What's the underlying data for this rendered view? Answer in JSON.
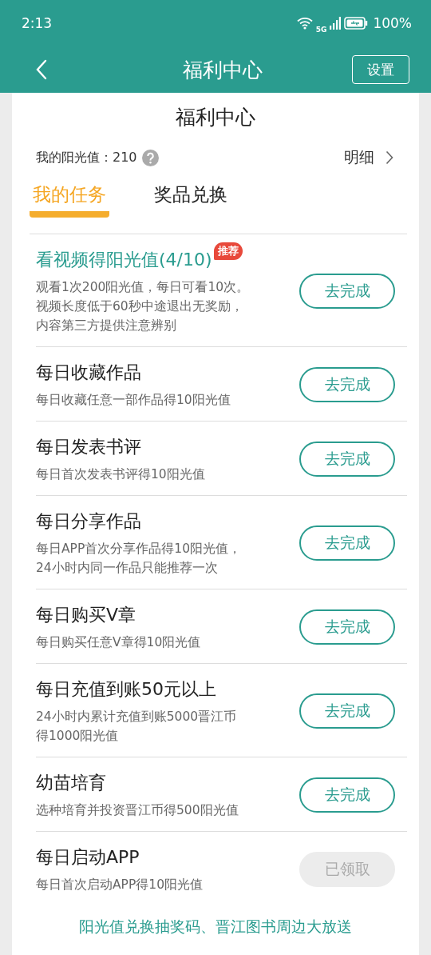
{
  "status_bar": {
    "time": "2:13",
    "network": "5G",
    "battery": "100%"
  },
  "header": {
    "title": "福利中心",
    "settings_button": "设置"
  },
  "card": {
    "title": "福利中心",
    "sunshine_label": "我的阳光值：",
    "sunshine_value": "210",
    "detail_link": "明细"
  },
  "tabs": [
    {
      "label": "我的任务",
      "selected": true
    },
    {
      "label": "奖品兑换",
      "selected": false
    }
  ],
  "tasks": [
    {
      "title": "看视频得阳光值(4/10)",
      "featured": true,
      "badge": "推荐",
      "desc_lines": [
        "观看1次200阳光值，每日可看10次。",
        "视频长度低于60秒中途退出无奖励，",
        "内容第三方提供注意辨别"
      ],
      "button": "去完成",
      "claimed": false
    },
    {
      "title": "每日收藏作品",
      "featured": false,
      "desc_lines": [
        "每日收藏任意一部作品得10阳光值"
      ],
      "button": "去完成",
      "claimed": false
    },
    {
      "title": "每日发表书评",
      "featured": false,
      "desc_lines": [
        "每日首次发表书评得10阳光值"
      ],
      "button": "去完成",
      "claimed": false
    },
    {
      "title": "每日分享作品",
      "featured": false,
      "desc_lines": [
        "每日APP首次分享作品得10阳光值，",
        "24小时内同一作品只能推荐一次"
      ],
      "button": "去完成",
      "claimed": false
    },
    {
      "title": "每日购买V章",
      "featured": false,
      "desc_lines": [
        "每日购买任意V章得10阳光值"
      ],
      "button": "去完成",
      "claimed": false
    },
    {
      "title": "每日充值到账50元以上",
      "featured": false,
      "desc_lines": [
        "24小时内累计充值到账5000晋江币",
        "得1000阳光值"
      ],
      "button": "去完成",
      "claimed": false
    },
    {
      "title": "幼苗培育",
      "featured": false,
      "desc_lines": [
        "选种培育并投资晋江币得500阳光值"
      ],
      "button": "去完成",
      "claimed": false
    },
    {
      "title": "每日启动APP",
      "featured": false,
      "desc_lines": [
        "每日首次启动APP得10阳光值"
      ],
      "button": "已领取",
      "claimed": true
    }
  ],
  "footer_link": "阳光值兑换抽奖码、晋江图书周边大放送"
}
